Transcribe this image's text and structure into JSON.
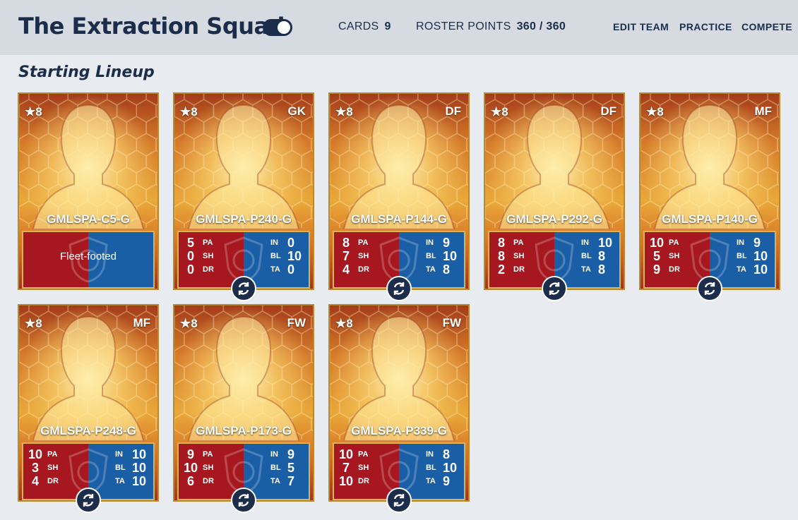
{
  "header": {
    "team_name": "The Extraction Squad",
    "cards_label": "CARDS",
    "cards_value": "9",
    "points_label": "ROSTER POINTS",
    "points_value": "360 / 360",
    "nav": {
      "edit": "EDIT TEAM",
      "practice": "PRACTICE",
      "compete": "COMPETE"
    }
  },
  "section_title": "Starting Lineup",
  "stat_labels": {
    "pa": "PA",
    "sh": "SH",
    "dr": "DR",
    "in": "IN",
    "bl": "BL",
    "ta": "TA"
  },
  "cards": [
    {
      "rating": "★8",
      "pos": "",
      "name": "GMLSPA-C5-G",
      "trait": "Fleet-footed"
    },
    {
      "rating": "★8",
      "pos": "GK",
      "name": "GMLSPA-P240-G",
      "pa": "5",
      "sh": "0",
      "dr": "0",
      "in": "0",
      "bl": "10",
      "ta": "0"
    },
    {
      "rating": "★8",
      "pos": "DF",
      "name": "GMLSPA-P144-G",
      "pa": "8",
      "sh": "7",
      "dr": "4",
      "in": "9",
      "bl": "10",
      "ta": "8"
    },
    {
      "rating": "★8",
      "pos": "DF",
      "name": "GMLSPA-P292-G",
      "pa": "8",
      "sh": "8",
      "dr": "2",
      "in": "10",
      "bl": "8",
      "ta": "8"
    },
    {
      "rating": "★8",
      "pos": "MF",
      "name": "GMLSPA-P140-G",
      "pa": "10",
      "sh": "5",
      "dr": "9",
      "in": "9",
      "bl": "10",
      "ta": "10"
    },
    {
      "rating": "★8",
      "pos": "MF",
      "name": "GMLSPA-P248-G",
      "pa": "10",
      "sh": "3",
      "dr": "4",
      "in": "10",
      "bl": "10",
      "ta": "10"
    },
    {
      "rating": "★8",
      "pos": "FW",
      "name": "GMLSPA-P173-G",
      "pa": "9",
      "sh": "10",
      "dr": "6",
      "in": "9",
      "bl": "5",
      "ta": "7"
    },
    {
      "rating": "★8",
      "pos": "FW",
      "name": "GMLSPA-P339-G",
      "pa": "10",
      "sh": "7",
      "dr": "10",
      "in": "8",
      "bl": "10",
      "ta": "9"
    }
  ],
  "colors": {
    "navy": "#1c2c4b",
    "header_bg": "#d5dbe1",
    "page_bg": "#e8ecf0",
    "red_panel": "#a6171f",
    "blue_panel": "#1a5fa5",
    "gold": "#b78a2f"
  },
  "icons": {
    "swap": "swap-arrows-icon",
    "toggle": "toggle-switch"
  }
}
